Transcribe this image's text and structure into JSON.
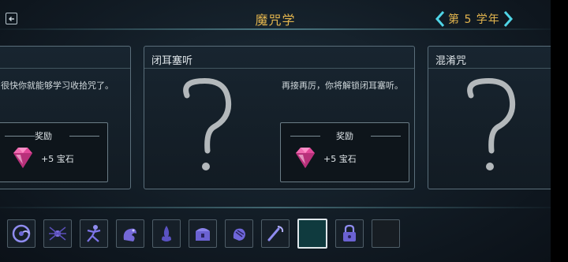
{
  "header": {
    "title": "魔咒学",
    "year_label": "第 5 学年"
  },
  "cards": [
    {
      "title": "",
      "description": "很快你就能够学习收拾咒了。",
      "reward_label": "奖励",
      "reward_value": "+5 宝石"
    },
    {
      "title": "闭耳塞听",
      "description": "再接再厉，你将解锁闭耳塞听。",
      "reward_label": "奖励",
      "reward_value": "+5 宝石"
    },
    {
      "title": "混淆咒"
    }
  ],
  "spell_bar": {
    "slots": [
      {
        "icon": "swirl-spell-icon"
      },
      {
        "icon": "spider-spell-icon"
      },
      {
        "icon": "figure-spell-icon"
      },
      {
        "icon": "creature-spell-icon"
      },
      {
        "icon": "flame-spell-icon"
      },
      {
        "icon": "chest-spell-icon"
      },
      {
        "icon": "hand-spell-icon"
      },
      {
        "icon": "wand-spell-icon"
      },
      {
        "icon": "selected-empty-slot"
      },
      {
        "icon": "padlock-spell-icon"
      },
      {
        "icon": "empty-slot"
      }
    ]
  },
  "colors": {
    "accent_gold": "#e3b54e",
    "chevron_cyan": "#4fd4e6",
    "gem_pink": "#e2489a"
  }
}
